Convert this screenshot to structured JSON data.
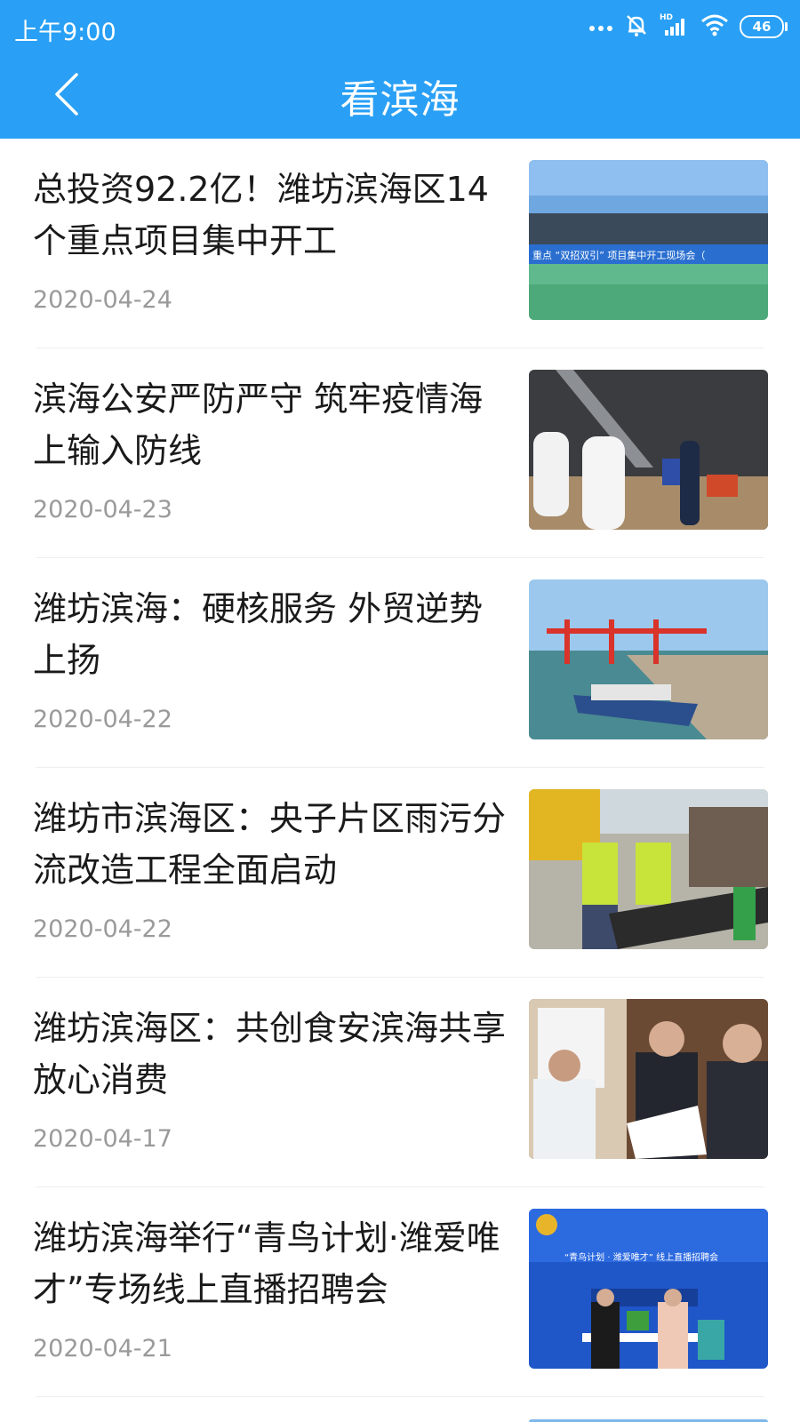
{
  "status_bar": {
    "time": "上午9:00",
    "battery": "46",
    "icons": [
      "more-dots-icon",
      "mute-icon",
      "hd-signal-icon",
      "wifi-icon",
      "battery-icon"
    ]
  },
  "header": {
    "title": "看滨海",
    "back_icon": "chevron-left-icon",
    "color": "#29a0f5"
  },
  "news": [
    {
      "title": "总投资92.2亿！潍坊滨海区14个重点项目集中开工",
      "date": "2020-04-24",
      "thumb_banner": "重点 “双招双引” 项目集中开工现场会（"
    },
    {
      "title": "滨海公安严防严守 筑牢疫情海上输入防线",
      "date": "2020-04-23"
    },
    {
      "title": "潍坊滨海：硬核服务 外贸逆势上扬",
      "date": "2020-04-22"
    },
    {
      "title": "潍坊市滨海区：央子片区雨污分流改造工程全面启动",
      "date": "2020-04-22"
    },
    {
      "title": "潍坊滨海区：共创食安滨海共享放心消费",
      "date": "2020-04-17"
    },
    {
      "title": "潍坊滨海举行“青鸟计划·潍爱唯才”专场线上直播招聘会",
      "date": "2020-04-21",
      "thumb_banner": "“青鸟计划 · 潍爱唯才” 线上直播招聘会"
    }
  ]
}
